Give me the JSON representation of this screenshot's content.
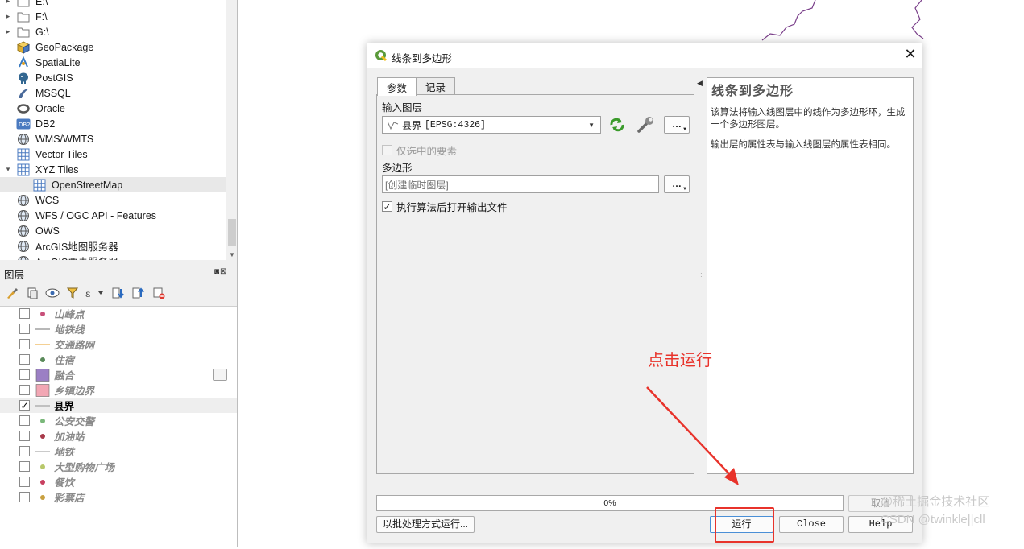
{
  "browser": {
    "items": [
      {
        "label": "E:\\",
        "icon": "folder-icon",
        "expandable": true
      },
      {
        "label": "F:\\",
        "icon": "folder-icon",
        "expandable": true
      },
      {
        "label": "G:\\",
        "icon": "folder-icon",
        "expandable": true
      },
      {
        "label": "GeoPackage",
        "icon": "geopackage-icon",
        "expandable": false
      },
      {
        "label": "SpatiaLite",
        "icon": "spatialite-icon",
        "expandable": false
      },
      {
        "label": "PostGIS",
        "icon": "postgis-elephant-icon",
        "expandable": false
      },
      {
        "label": "MSSQL",
        "icon": "mssql-icon",
        "expandable": false
      },
      {
        "label": "Oracle",
        "icon": "oracle-icon",
        "expandable": false
      },
      {
        "label": "DB2",
        "icon": "db2-icon",
        "expandable": false
      },
      {
        "label": "WMS/WMTS",
        "icon": "globe-icon",
        "expandable": false
      },
      {
        "label": "Vector Tiles",
        "icon": "grid-icon",
        "expandable": false
      },
      {
        "label": "XYZ Tiles",
        "icon": "grid-icon",
        "expandable": true,
        "expanded": true
      },
      {
        "label": "OpenStreetMap",
        "icon": "grid-icon",
        "expandable": false,
        "child": true,
        "selected": true
      },
      {
        "label": "WCS",
        "icon": "globe-icon",
        "expandable": false
      },
      {
        "label": "WFS / OGC API - Features",
        "icon": "globe-icon",
        "expandable": false
      },
      {
        "label": "OWS",
        "icon": "globe-icon",
        "expandable": false
      },
      {
        "label": "ArcGIS地图服务器",
        "icon": "globe-icon",
        "expandable": false
      },
      {
        "label": "ArcGIS要素服务器",
        "icon": "globe-icon",
        "expandable": false
      }
    ]
  },
  "layers_panel": {
    "title": "图层",
    "window_buttons": "◙⊠",
    "layers": [
      {
        "name": "山峰点",
        "checked": false,
        "symbol": "dot",
        "color": "#c8507a"
      },
      {
        "name": "地铁线",
        "checked": false,
        "symbol": "line",
        "color": "#a0a0a0"
      },
      {
        "name": "交通路网",
        "checked": false,
        "symbol": "line",
        "color": "#f0c070"
      },
      {
        "name": "住宿",
        "checked": false,
        "symbol": "dot",
        "color": "#5a8a5a"
      },
      {
        "name": "融合",
        "checked": false,
        "symbol": "fill",
        "color": "#9b7fc4",
        "filter": true
      },
      {
        "name": "乡镇边界",
        "checked": false,
        "symbol": "fill",
        "color": "#f2a7b4"
      },
      {
        "name": "县界",
        "checked": true,
        "symbol": "line",
        "color": "#b0b0b0",
        "current": true
      },
      {
        "name": "公安交警",
        "checked": false,
        "symbol": "dot",
        "color": "#7ab87a"
      },
      {
        "name": "加油站",
        "checked": false,
        "symbol": "dot",
        "color": "#a83a4a"
      },
      {
        "name": "地铁",
        "checked": false,
        "symbol": "line",
        "color": "#b8b8b8"
      },
      {
        "name": "大型购物广场",
        "checked": false,
        "symbol": "dot",
        "color": "#b8c86a"
      },
      {
        "name": "餐饮",
        "checked": false,
        "symbol": "dot",
        "color": "#c84060"
      },
      {
        "name": "彩票店",
        "checked": false,
        "symbol": "dot",
        "color": "#c8a040"
      }
    ]
  },
  "dialog": {
    "title": "线条到多边形",
    "close_glyph": "✕",
    "tabs": [
      "参数",
      "记录"
    ],
    "input_layer_label": "输入图层",
    "input_layer_name": "县界",
    "input_layer_crs": "[EPSG:4326]",
    "selected_only_label": "仅选中的要素",
    "output_label": "多边形",
    "output_placeholder": "[创建临时图层]",
    "open_output_label": "执行算法后打开输出文件",
    "dots": "…",
    "help_title": "线条到多边形",
    "help_p1": "该算法将输入线图层中的线作为多边形环，生成一个多边形图层。",
    "help_p2": "输出层的属性表与输入线图层的属性表相同。",
    "progress_text": "0%",
    "cancel_label": "取消",
    "batch_label": "以批处理方式运行...",
    "run_label": "运行",
    "close_label": "Close",
    "help_label": "Help"
  },
  "annotation": {
    "text": "点击运行",
    "color": "#e8332b"
  },
  "watermark": {
    "line1": "@稀土掘金技术社区",
    "line2": "CSDN @twinkle||cll"
  }
}
